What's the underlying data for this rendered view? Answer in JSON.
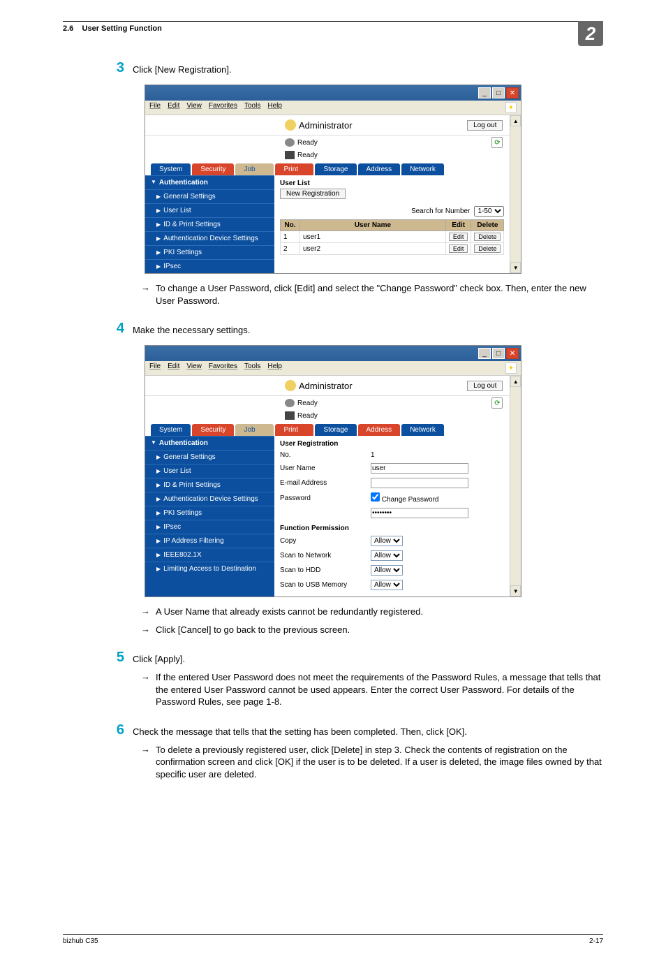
{
  "header": {
    "section": "2.6",
    "title": "User Setting Function",
    "chapter": "2"
  },
  "steps": {
    "s3": {
      "num": "3",
      "text": "Click [New Registration]."
    },
    "s3_note": "To change a User Password, click [Edit] and select the \"Change Password\" check box. Then, enter the new User Password.",
    "s4": {
      "num": "4",
      "text": "Make the necessary settings."
    },
    "s4_note1": "A User Name that already exists cannot be redundantly registered.",
    "s4_note2": "Click [Cancel] to go back to the previous screen.",
    "s5": {
      "num": "5",
      "text": "Click [Apply]."
    },
    "s5_note": "If the entered User Password does not meet the requirements of the Password Rules, a message that tells that the entered User Password cannot be used appears. Enter the correct User Password. For details of the Password Rules, see page 1-8.",
    "s6": {
      "num": "6",
      "text": "Check the message that tells that the setting has been completed. Then, click [OK]."
    },
    "s6_note": "To delete a previously registered user, click [Delete] in step 3. Check the contents of registration on the confirmation screen and click [OK] if the user is to be deleted. If a user is deleted, the image files owned by that specific user are deleted."
  },
  "menubar": {
    "file": "File",
    "edit": "Edit",
    "view": "View",
    "fav": "Favorites",
    "tools": "Tools",
    "help": "Help"
  },
  "app": {
    "admin": "Administrator",
    "logout": "Log out",
    "ready": "Ready",
    "tabs": {
      "system": "System",
      "security": "Security",
      "job": "Job",
      "print": "Print",
      "storage": "Storage",
      "address": "Address",
      "network": "Network"
    }
  },
  "sidebar": {
    "auth": "Authentication",
    "general": "General Settings",
    "userlist": "User List",
    "idprint": "ID & Print Settings",
    "authdev": "Authentication Device Settings",
    "pki": "PKI Settings",
    "ipsec": "IPsec",
    "ipfilter": "IP Address Filtering",
    "ieee": "IEEE802.1X",
    "limiting": "Limiting Access to Destination"
  },
  "userlist_panel": {
    "title": "User List",
    "newreg": "New Registration",
    "search": "Search for Number",
    "range": "1-50",
    "col_no": "No.",
    "col_user": "User Name",
    "col_edit": "Edit",
    "col_delete": "Delete",
    "rows": [
      {
        "no": "1",
        "name": "user1"
      },
      {
        "no": "2",
        "name": "user2"
      }
    ],
    "edit": "Edit",
    "delete": "Delete"
  },
  "userreg_panel": {
    "title": "User Registration",
    "no_lbl": "No.",
    "no_val": "1",
    "name_lbl": "User Name",
    "name_val": "user",
    "email_lbl": "E-mail Address",
    "pwd_lbl": "Password",
    "change_pwd": "Change Password",
    "pwd_val": "••••••••",
    "funcperm": "Function Permission",
    "copy": "Copy",
    "scan_net": "Scan to Network",
    "scan_hdd": "Scan to HDD",
    "scan_usb": "Scan to USB Memory",
    "allow": "Allow"
  },
  "footer": {
    "product": "bizhub C35",
    "page": "2-17"
  }
}
